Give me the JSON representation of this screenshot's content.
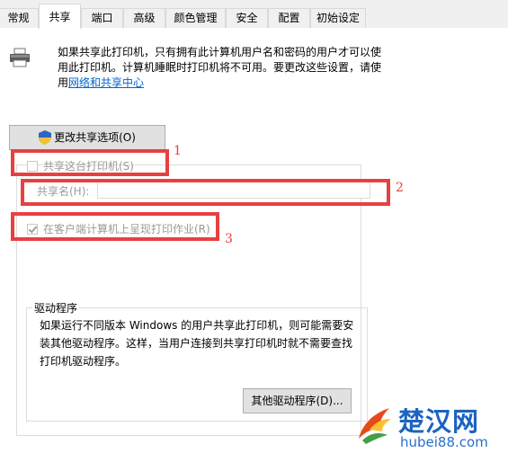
{
  "tabs": [
    {
      "label": "常规"
    },
    {
      "label": "共享"
    },
    {
      "label": "端口"
    },
    {
      "label": "高级"
    },
    {
      "label": "颜色管理"
    },
    {
      "label": "安全"
    },
    {
      "label": "配置"
    },
    {
      "label": "初始设定"
    }
  ],
  "active_tab": "共享",
  "description": {
    "line1": "如果共享此打印机，只有拥有此计算机用户名和密码的用户才可以使",
    "line2": "用此打印机。计算机睡眠时打印机将不可用。要更改这些设置，请使",
    "line3_prefix": "用",
    "link": "网络和共享中心"
  },
  "change_sharing_button": "更改共享选项(O)",
  "share_printer": {
    "label": "共享这台打印机(S)",
    "checked": false
  },
  "share_name": {
    "label": "共享名(H):",
    "value": ""
  },
  "render_jobs": {
    "label": "在客户端计算机上呈现打印作业(R)",
    "checked": true
  },
  "annotations": [
    "1",
    "2",
    "3"
  ],
  "drivers": {
    "legend": "驱动程序",
    "text_line1": "如果运行不同版本 Windows 的用户共享此打印机，则可能需要安",
    "text_line2": "装其他驱动程序。这样，当用户连接到共享打印机时就不需要查找",
    "text_line3": "打印机驱动程序。",
    "button": "其他驱动程序(D)..."
  },
  "watermark": {
    "title": "楚汉网",
    "url": "hubei88.com"
  },
  "colors": {
    "annotation_red": "#e84040",
    "link_blue": "#0066cc",
    "watermark_blue": "#1b63c0"
  }
}
